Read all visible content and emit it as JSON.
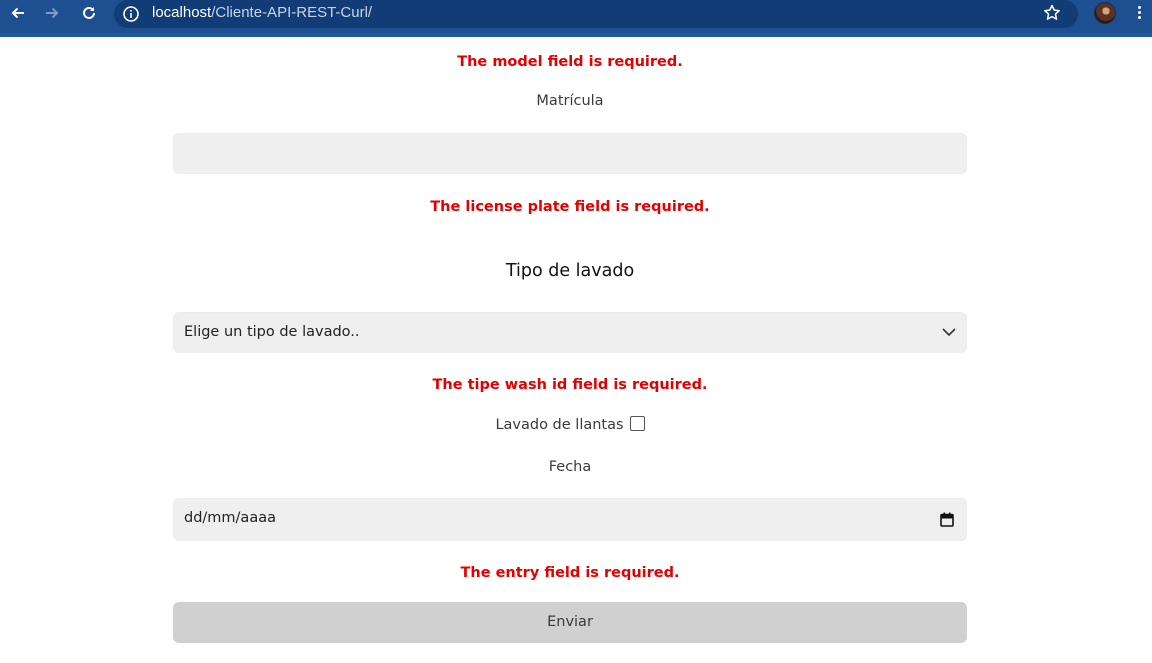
{
  "browser": {
    "url_host": "localhost",
    "url_path": "/Cliente-API-REST-Curl/",
    "back_icon": "arrow-left-icon",
    "forward_icon": "arrow-right-icon",
    "reload_icon": "reload-icon",
    "info_icon": "info-icon",
    "star_icon": "star-icon",
    "menu_icon": "kebab-menu-icon"
  },
  "form": {
    "error_model": "The model field is required.",
    "plate_label": "Matrícula",
    "plate_value": "",
    "error_plate": "The license plate field is required.",
    "wash_heading": "Tipo de lavado",
    "wash_select_value": "Elige un tipo de lavado..",
    "error_wash": "The tipe wash id field is required.",
    "tires_label": "Lavado de llantas",
    "tires_checked": false,
    "date_label": "Fecha",
    "date_placeholder": "dd/mm/aaaa",
    "error_entry": "The entry field is required.",
    "submit_label": "Enviar"
  },
  "colors": {
    "chrome": "#1d4f91",
    "error": "#e30000",
    "field_bg": "#efefef",
    "button_bg": "#d0d0d0"
  }
}
